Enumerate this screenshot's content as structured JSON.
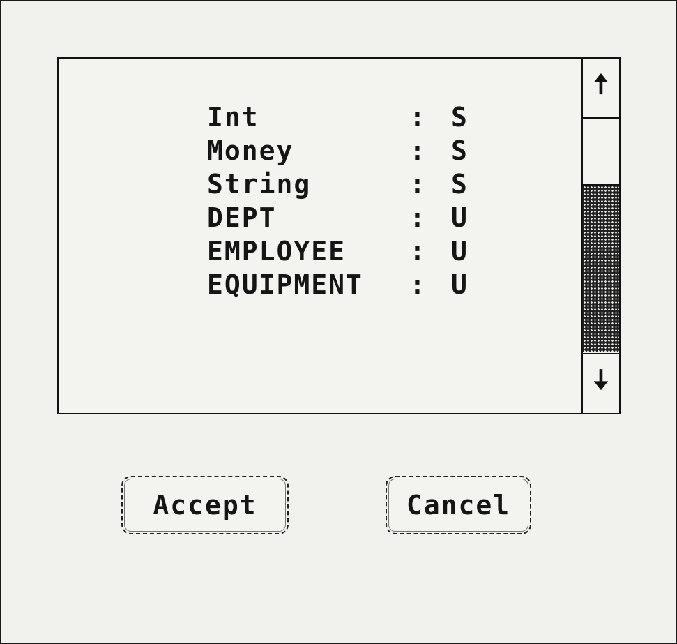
{
  "list": {
    "items": [
      {
        "name": "Int",
        "sep": ":",
        "kind": "S"
      },
      {
        "name": "Money",
        "sep": ":",
        "kind": "S"
      },
      {
        "name": "String",
        "sep": ":",
        "kind": "S"
      },
      {
        "name": "DEPT",
        "sep": ":",
        "kind": "U"
      },
      {
        "name": "EMPLOYEE",
        "sep": ":",
        "kind": "U"
      },
      {
        "name": "EQUIPMENT",
        "sep": ":",
        "kind": "U"
      }
    ]
  },
  "scrollbar": {
    "up_icon": "arrow-up-icon",
    "down_icon": "arrow-down-icon",
    "up_glyph": "🠅",
    "down_glyph": "🠇"
  },
  "buttons": {
    "accept_label": "Accept",
    "cancel_label": "Cancel"
  }
}
